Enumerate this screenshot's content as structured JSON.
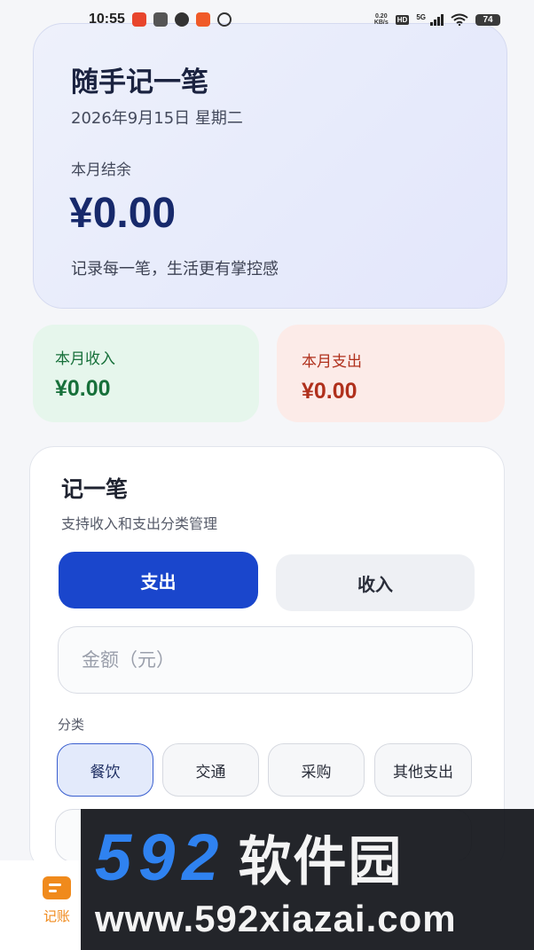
{
  "status_bar": {
    "time": "10:55",
    "network_speed_value": "0.20",
    "network_speed_unit": "KB/s",
    "hd_badge": "HD",
    "network_type": "5G",
    "battery": "74",
    "app_icon_colors": [
      "#e8452c",
      "#555555",
      "#333333",
      "#f05a28",
      "#333333"
    ]
  },
  "hero": {
    "title": "随手记一笔",
    "date": "2026年9月15日 星期二",
    "balance_label": "本月结余",
    "balance_value": "¥0.00",
    "slogan": "记录每一笔，生活更有掌控感"
  },
  "summary": {
    "income_label": "本月收入",
    "income_value": "¥0.00",
    "expense_label": "本月支出",
    "expense_value": "¥0.00"
  },
  "record": {
    "title": "记一笔",
    "subtitle": "支持收入和支出分类管理",
    "type_expense": "支出",
    "type_income": "收入",
    "selected_type": "支出",
    "amount_placeholder": "金额（元）",
    "amount_value": "",
    "category_label": "分类",
    "categories": [
      "餐饮",
      "交通",
      "采购",
      "其他支出"
    ],
    "selected_category": "餐饮"
  },
  "bottom_nav": {
    "items": [
      {
        "label": "记账",
        "icon": "ledger-icon",
        "active": true
      }
    ]
  },
  "watermark": {
    "digits": "592",
    "name": "软件园",
    "url": "www.592xiazai.com"
  },
  "colors": {
    "primary": "#1a46cc",
    "income_text": "#17703a",
    "expense_text": "#b0301c",
    "nav_accent": "#f08a1c",
    "watermark_blue": "#2f82f0"
  }
}
